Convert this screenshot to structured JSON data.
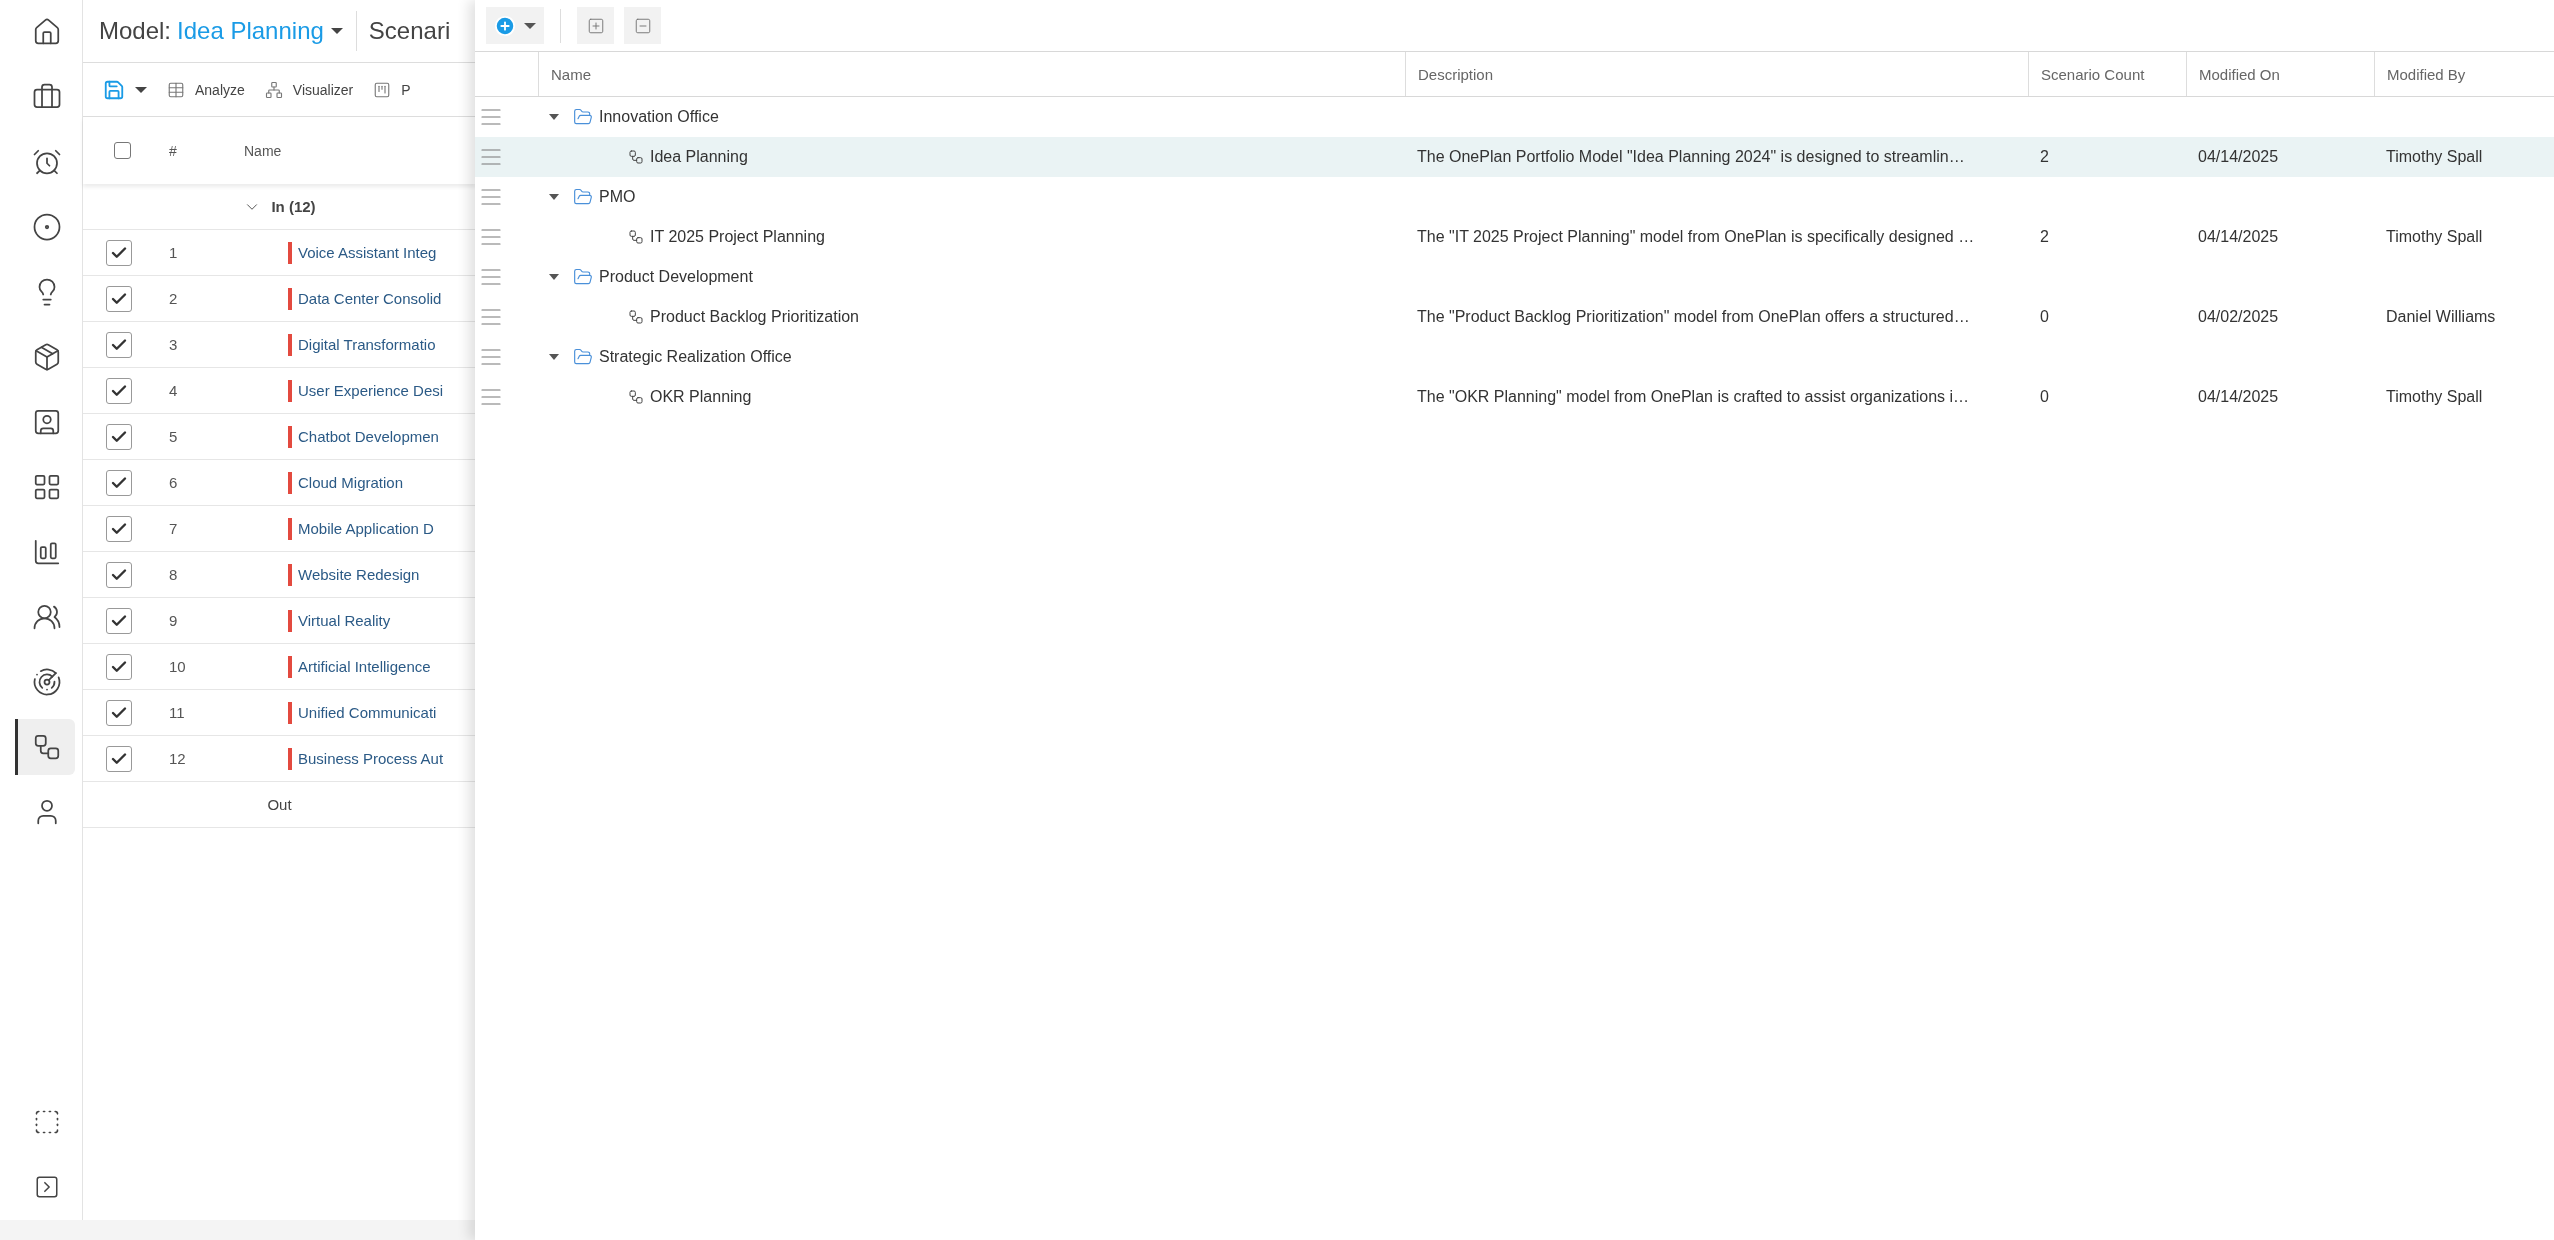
{
  "nav_items": [
    {
      "selected": false
    },
    {
      "selected": false
    },
    {
      "selected": false
    },
    {
      "selected": false
    },
    {
      "selected": false
    },
    {
      "selected": false
    },
    {
      "selected": false
    },
    {
      "selected": false
    },
    {
      "selected": false
    },
    {
      "selected": false
    },
    {
      "selected": false
    },
    {
      "selected": true
    },
    {
      "selected": false
    }
  ],
  "model_header": {
    "label": "Model:",
    "value": "Idea Planning",
    "next_title": "Scenari"
  },
  "toolbar": [
    "Analyze",
    "Visualizer",
    "P"
  ],
  "grid": {
    "all_checked": false,
    "columns": [
      "#",
      "Name"
    ],
    "groups": [
      {
        "kind": "group",
        "label": "In (12)",
        "expanded": true,
        "rows": [
          {
            "number": "1",
            "name": "Voice Assistant Integ",
            "checked": true
          },
          {
            "number": "2",
            "name": "Data Center Consolid",
            "checked": true
          },
          {
            "number": "3",
            "name": "Digital Transformatio",
            "checked": true
          },
          {
            "number": "4",
            "name": "User Experience Desi",
            "checked": true
          },
          {
            "number": "5",
            "name": "Chatbot Developmen",
            "checked": true
          },
          {
            "number": "6",
            "name": "Cloud Migration",
            "checked": true
          },
          {
            "number": "7",
            "name": "Mobile Application D",
            "checked": true
          },
          {
            "number": "8",
            "name": "Website Redesign",
            "checked": true
          },
          {
            "number": "9",
            "name": "Virtual Reality",
            "checked": true
          },
          {
            "number": "10",
            "name": "Artificial Intelligence",
            "checked": true
          },
          {
            "number": "11",
            "name": "Unified Communicati",
            "checked": true
          },
          {
            "number": "12",
            "name": "Business Process Aut",
            "checked": true
          }
        ]
      },
      {
        "kind": "plain",
        "label": "Out"
      }
    ]
  },
  "models_panel": {
    "columns": [
      "Name",
      "Description",
      "Scenario Count",
      "Modified On",
      "Modified By"
    ],
    "folders": [
      {
        "name": "Innovation Office",
        "expanded": true,
        "selected": false,
        "children": [
          {
            "name": "Idea Planning",
            "description": "The OnePlan Portfolio Model \"Idea Planning 2024\" is designed to streamlin…",
            "scenario_count": "2",
            "modified_on": "04/14/2025",
            "modified_by": "Timothy Spall",
            "selected": true
          }
        ]
      },
      {
        "name": "PMO",
        "expanded": true,
        "selected": false,
        "children": [
          {
            "name": "IT 2025 Project Planning",
            "description": "The \"IT 2025 Project Planning\" model from OnePlan is specifically designed …",
            "scenario_count": "2",
            "modified_on": "04/14/2025",
            "modified_by": "Timothy Spall",
            "selected": false
          }
        ]
      },
      {
        "name": "Product Development",
        "expanded": true,
        "selected": false,
        "children": [
          {
            "name": "Product Backlog Prioritization",
            "description": "The \"Product Backlog Prioritization\" model from OnePlan offers a structured…",
            "scenario_count": "0",
            "modified_on": "04/02/2025",
            "modified_by": "Daniel Williams",
            "selected": false
          }
        ]
      },
      {
        "name": "Strategic Realization Office",
        "expanded": true,
        "selected": false,
        "children": [
          {
            "name": "OKR Planning",
            "description": "The \"OKR Planning\" model from OnePlan is crafted to assist organizations i…",
            "scenario_count": "0",
            "modified_on": "04/14/2025",
            "modified_by": "Timothy Spall",
            "selected": false
          }
        ]
      }
    ]
  }
}
